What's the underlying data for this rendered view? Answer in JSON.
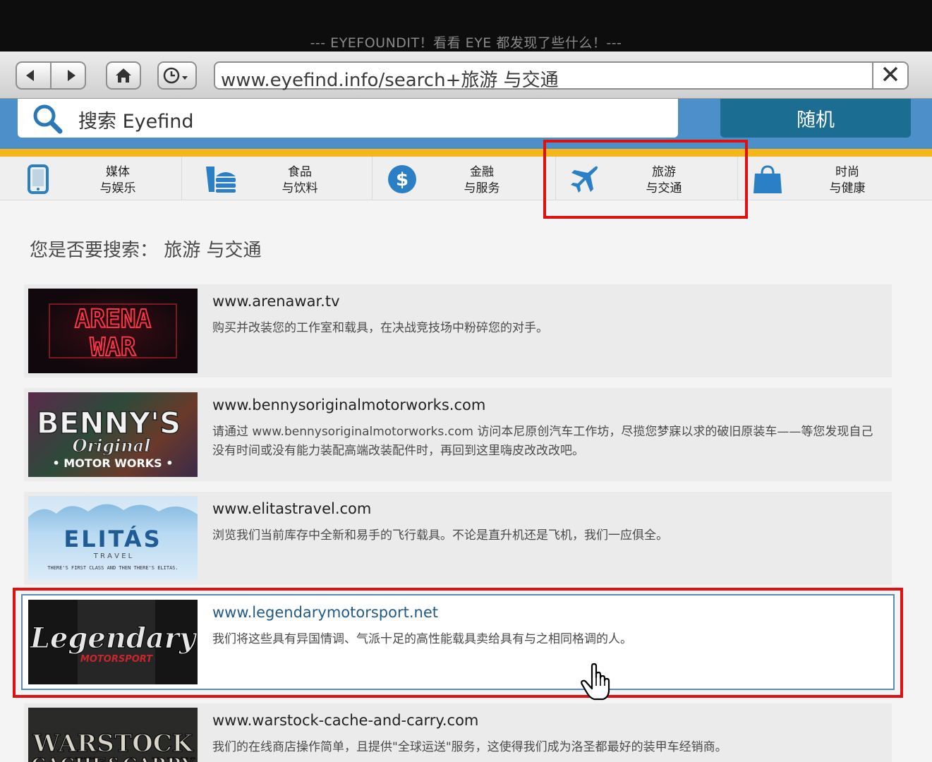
{
  "window": {
    "title": "--- EYEFOUNDIT！看看 EYE 都发现了些什么！---"
  },
  "toolbar": {
    "back_icon": "back-arrow-icon",
    "forward_icon": "forward-arrow-icon",
    "home_icon": "home-icon",
    "history_icon": "clock-dropdown-icon",
    "url": "www.eyefind.info/search+旅游 与交通",
    "close_icon": "close-x-icon"
  },
  "search": {
    "placeholder": "搜索 Eyefind",
    "random_label": "随机"
  },
  "categories": [
    {
      "line1": "媒体",
      "line2": "与娱乐",
      "icon": "tablet-icon"
    },
    {
      "line1": "食品",
      "line2": "与饮料",
      "icon": "food-tray-icon"
    },
    {
      "line1": "金融",
      "line2": "与服务",
      "icon": "dollar-icon"
    },
    {
      "line1": "旅游",
      "line2": "与交通",
      "icon": "airplane-icon"
    },
    {
      "line1": "时尚",
      "line2": "与健康",
      "icon": "shopping-bag-icon"
    }
  ],
  "question": {
    "text": "您是否要搜索： 旅游 与交通"
  },
  "results": [
    {
      "url": "www.arenawar.tv",
      "desc": "购买并改装您的工作室和载具，在决战竞技场中粉碎您的对手。",
      "thumb_line1": "ARENA",
      "thumb_line2": "WAR"
    },
    {
      "url": "www.bennysoriginalmotorworks.com",
      "desc": "请通过 www.bennysoriginalmotorworks.com 访问本尼原创汽车工作坊，尽揽您梦寐以求的破旧原装车——等您发现自己没有时间或没有能力装配高端改装配件时，再回到这里嗨皮改改改吧。",
      "thumb_line1": "BENNY'S",
      "thumb_line2": "Original",
      "thumb_line3": "• MOTOR WORKS •"
    },
    {
      "url": "www.elitastravel.com",
      "desc": "浏览我们当前库存中全新和易手的飞行载具。不论是直升机还是飞机，我们一应俱全。",
      "thumb_line1": "ELITÁS",
      "thumb_line2": "T R A V E L",
      "thumb_line3": "THERE'S FIRST CLASS AND THEN THERE'S ELITAS."
    },
    {
      "url": "www.legendarymotorsport.net",
      "desc": "我们将这些具有异国情调、气派十足的高性能载具卖给具有与之相同格调的人。",
      "thumb_line1": "Legendary",
      "thumb_line2": "MOTORSPORT"
    },
    {
      "url": "www.warstock-cache-and-carry.com",
      "desc": "我们的在线商店操作简单，且提供\"全球运送\"服务，这使得我们成为洛圣都最好的装甲车经销商。",
      "thumb_line1": "WARSTOCK",
      "thumb_line2": "CACHE&CARRY"
    }
  ],
  "colors": {
    "search_bar": "#4d8fc9",
    "random_button": "#1b6d91",
    "accent_yellow": "#f3b71a",
    "highlight_red": "#e01010",
    "link_blue": "#1f5a8a"
  }
}
